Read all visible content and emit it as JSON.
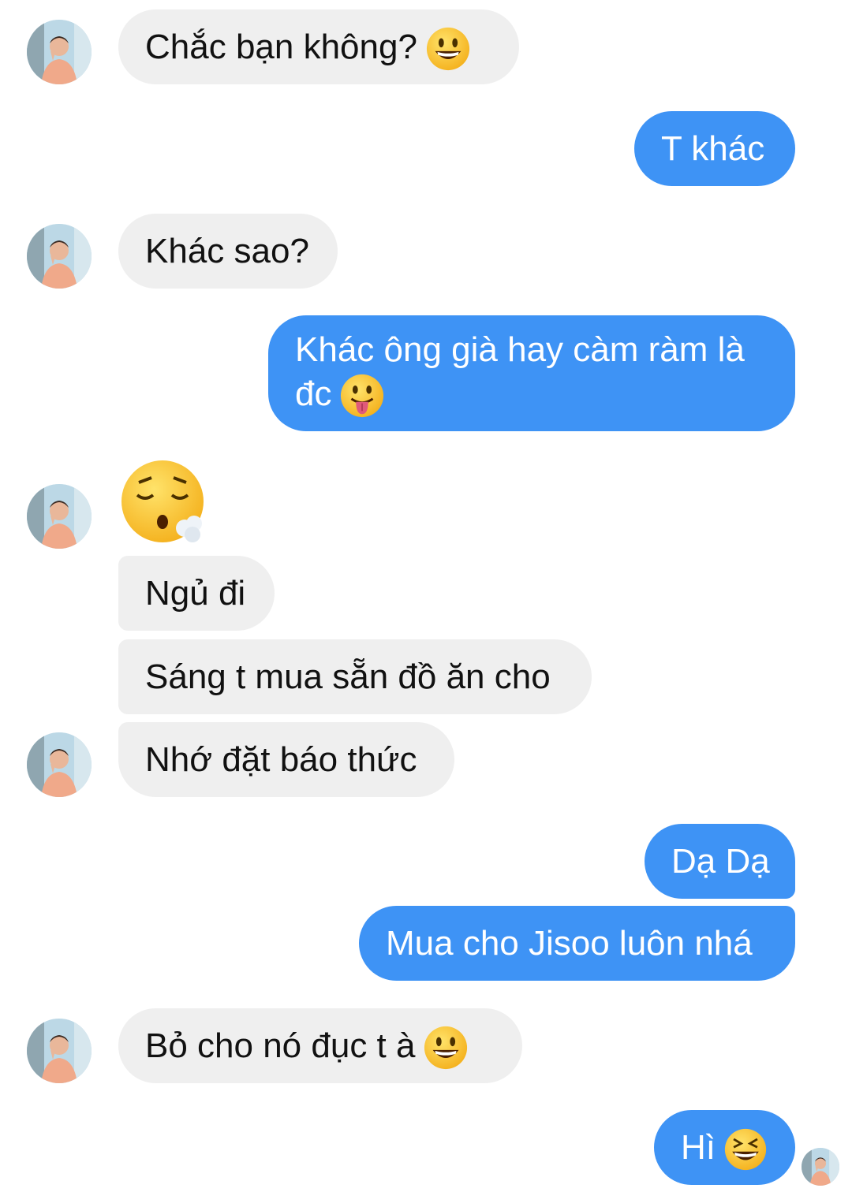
{
  "messages": [
    {
      "from": "contact",
      "text": "Chắc bạn không?",
      "emoji": "grinning-face-emoji"
    },
    {
      "from": "me",
      "text": "T khác"
    },
    {
      "from": "contact",
      "text": "Khác sao?"
    },
    {
      "from": "me",
      "text": "Khác ông già hay càm ràm là đc",
      "emoji": "tongue-out-face-emoji"
    },
    {
      "from": "contact",
      "emoji": "exhaling-face-emoji"
    },
    {
      "from": "contact",
      "text": "Ngủ đi"
    },
    {
      "from": "contact",
      "text": "Sáng t mua sẵn đồ ăn cho"
    },
    {
      "from": "contact",
      "text": "Nhớ đặt báo thức"
    },
    {
      "from": "me",
      "text": "Dạ Dạ"
    },
    {
      "from": "me",
      "text": "Mua cho Jisoo luôn nhá"
    },
    {
      "from": "contact",
      "text": "Bỏ cho nó đục t à",
      "emoji": "grinning-face-emoji"
    },
    {
      "from": "me",
      "text": "Hì",
      "emoji": "squinting-laugh-face-emoji"
    }
  ],
  "colors": {
    "incoming_bubble": "#efefef",
    "outgoing_bubble": "#3e93f5",
    "incoming_text": "#111111",
    "outgoing_text": "#ffffff"
  }
}
